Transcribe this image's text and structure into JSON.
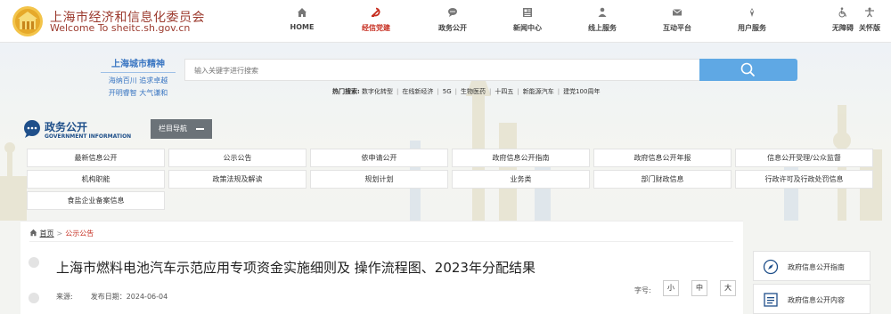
{
  "header": {
    "site_title": "上海市经济和信息化委员会",
    "site_url": "Welcome To sheitc.sh.gov.cn",
    "nav": [
      {
        "label": "HOME",
        "icon": "home-icon"
      },
      {
        "label": "经信党建",
        "icon": "party-emblem-icon",
        "active": true
      },
      {
        "label": "政务公开",
        "icon": "chat-bubble-icon"
      },
      {
        "label": "新闻中心",
        "icon": "newspaper-icon"
      },
      {
        "label": "线上服务",
        "icon": "person-service-icon"
      },
      {
        "label": "互动平台",
        "icon": "envelope-icon"
      },
      {
        "label": "用户服务",
        "icon": "user-service-icon"
      }
    ],
    "accessibility": [
      {
        "label": "无障碍",
        "icon": "wheelchair-icon"
      },
      {
        "label": "关怀版",
        "icon": "care-mode-icon"
      }
    ]
  },
  "spirit": {
    "title": "上海城市精神",
    "line1": "海纳百川  追求卓越",
    "line2": "开明睿智  大气谦和"
  },
  "search": {
    "placeholder": "输入关键字进行搜索",
    "hot_label": "热门搜索:",
    "hot_keywords": [
      "数字化转型",
      "在线新经济",
      "5G",
      "生物医药",
      "十四五",
      "新能源汽车",
      "建党100周年"
    ]
  },
  "section": {
    "title": "政务公开",
    "subtitle": "GOVERNMENT INFORMATION",
    "column_nav": "栏目导航"
  },
  "categories": [
    "最新信息公开",
    "公示公告",
    "依申请公开",
    "政府信息公开指南",
    "政府信息公开年报",
    "信息公开受理/公众监督",
    "机构职能",
    "政策法规及解读",
    "规划计划",
    "业务类",
    "部门财政信息",
    "行政许可及行政处罚信息",
    "食盐企业备案信息"
  ],
  "breadcrumb": {
    "home": "首页",
    "current": "公示公告"
  },
  "article": {
    "title": "上海市燃料电池汽车示范应用专项资金实施细则及 操作流程图、2023年分配结果",
    "source_label": "来源:",
    "date_label": "发布日期：2024-06-04",
    "font_size_label": "字号:",
    "font_sizes": [
      "小",
      "中",
      "大"
    ]
  },
  "sidebar": [
    {
      "label": "政府信息公开指南",
      "icon": "compass-icon"
    },
    {
      "label": "政府信息公开内容",
      "icon": "list-document-icon"
    }
  ],
  "colors": {
    "brand_red": "#c62e20",
    "title_red": "#9c3b2f",
    "accent_blue": "#5fa8e4",
    "section_blue": "#1f4f8a",
    "nav_button_gray": "#6b7278"
  }
}
